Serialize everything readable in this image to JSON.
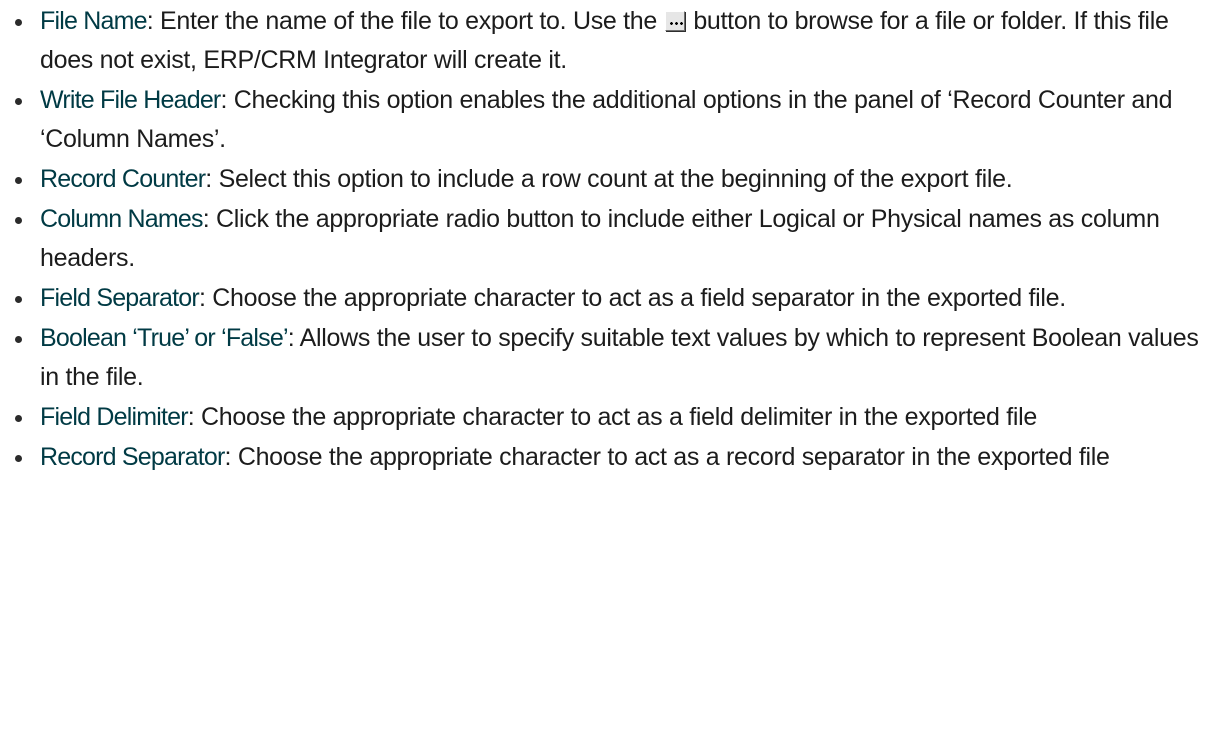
{
  "items": [
    {
      "term": "File Name",
      "desc_before": ": Enter the name of the file to export to. Use the ",
      "icon": "browse-ellipsis-button",
      "desc_after": " button to browse for a file or folder. If this file does not exist, ERP/CRM Integrator will create it."
    },
    {
      "term": "Write File Header",
      "desc": ": Checking this option enables the additional options in the panel of ‘Record Counter and ‘Column Names’."
    },
    {
      "term": "Record Counter",
      "desc": ": Select this option to include a row count at the beginning of the export file."
    },
    {
      "term": "Column Names",
      "desc": ": Click the appropriate radio button to include either Logical or Physical names as column headers."
    },
    {
      "term": "Field Separator",
      "desc": ": Choose the appropriate character to act as a field separator in the exported file."
    },
    {
      "term": "Boolean ‘True’ or ‘False’",
      "desc": ": Allows the user to specify suitable text values by which to rep­resent Boolean values in the file."
    },
    {
      "term": "Field Delimiter",
      "desc": ": Choose the appropriate character to act as a field delimiter in the expor­ted file"
    },
    {
      "term": "Record Separator",
      "desc": ": Choose the appropriate character to act as a record separator in the exported file"
    }
  ]
}
